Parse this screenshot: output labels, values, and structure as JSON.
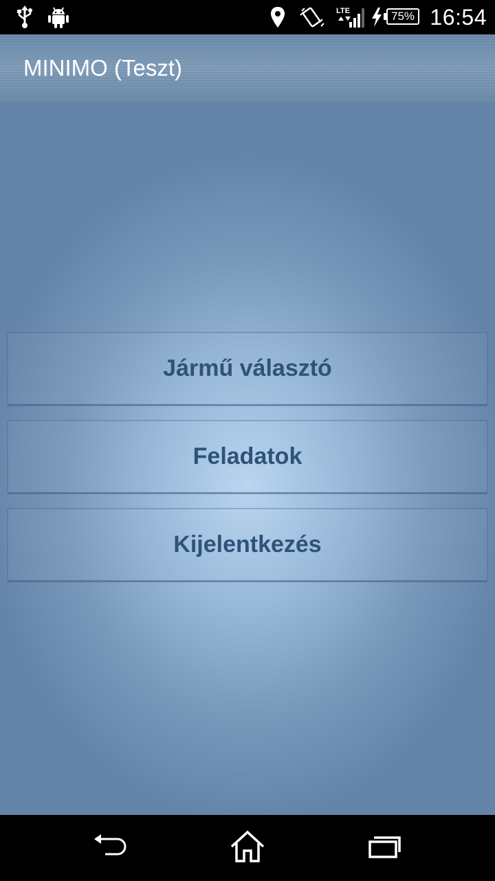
{
  "status_bar": {
    "icons": [
      "usb-icon",
      "android-icon",
      "location-icon",
      "vibrate-icon",
      "lte-signal-icon",
      "charging-icon"
    ],
    "network_label": "LTE",
    "battery": "75%",
    "time": "16:54"
  },
  "action_bar": {
    "title": "MINIMO (Teszt)"
  },
  "menu": {
    "buttons": [
      {
        "label": "Jármű választó"
      },
      {
        "label": "Feladatok"
      },
      {
        "label": "Kijelentkezés"
      }
    ]
  },
  "nav_bar": {
    "icons": [
      "back-icon",
      "home-icon",
      "recent-apps-icon"
    ]
  },
  "colors": {
    "action_bar": "#7393b3",
    "background_center": "#b7d4f0",
    "background_edge": "#6485a9",
    "button_text": "#2e5378"
  }
}
